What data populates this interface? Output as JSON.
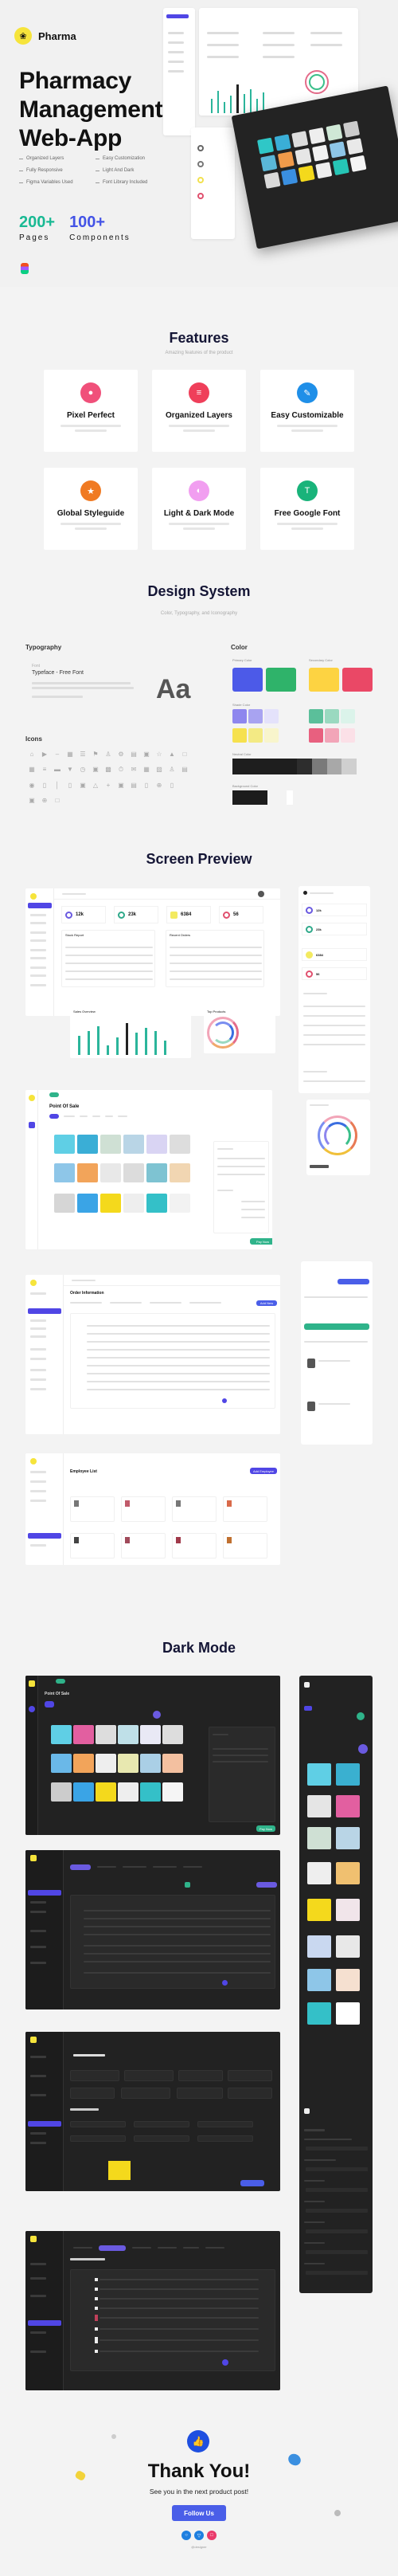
{
  "hero": {
    "brand": "Pharma",
    "title_lines": [
      "Pharmacy",
      "Management",
      "Web-App"
    ],
    "features": [
      "Organized Layers",
      "Easy Customization",
      "Fully Responsive",
      "Light And Dark",
      "Figma Variables Used",
      "Font Library Included"
    ],
    "stats": [
      {
        "value": "200+",
        "label": "Pages"
      },
      {
        "value": "100+",
        "label": "Components"
      }
    ]
  },
  "features_section": {
    "title": "Features",
    "subtitle": "Amazing features of the product",
    "items": [
      {
        "title": "Pixel Perfect",
        "icon": "pixel-icon",
        "color": "#f0507a"
      },
      {
        "title": "Organized Layers",
        "icon": "layers-icon",
        "color": "#ef3f5a"
      },
      {
        "title": "Easy Customizable",
        "icon": "customize-icon",
        "color": "#1f8fe8"
      },
      {
        "title": "Global Styleguide",
        "icon": "styleguide-icon",
        "color": "#f07a22"
      },
      {
        "title": "Light & Dark Mode",
        "icon": "theme-icon",
        "color": "#f19ef0"
      },
      {
        "title": "Free Google Font",
        "icon": "font-icon",
        "color": "#19b37a"
      }
    ]
  },
  "design_system": {
    "title": "Design System",
    "subtitle": "Color, Typography, and Iconography",
    "typography_label": "Typography",
    "font_caption": "Font",
    "font_name": "Typeface - Free Font",
    "sample_glyph": "Aa",
    "icons_label": "Icons",
    "color_label": "Color",
    "primary_label": "Primary Color",
    "secondary_label": "Secondary Color",
    "shade_label": "Shade Color",
    "neutral_label": "Neutral Color",
    "background_label": "Background Color",
    "colors": {
      "primary": [
        "#4c5ae8",
        "#2fb36a"
      ],
      "secondary": [
        "#fdd342",
        "#ea4866"
      ],
      "shades_purple": [
        "#8e86ee",
        "#a8a3f1",
        "#e4e2fb"
      ],
      "shades_green": [
        "#5bbf9a",
        "#9ad9c0",
        "#dbf3ea"
      ],
      "shades_yellow": [
        "#f6e14e",
        "#f3ea84",
        "#f8f5cc"
      ],
      "shades_pink": [
        "#e8607f",
        "#f2a5b8",
        "#fbe0e7"
      ],
      "neutral": [
        "#1e1e1e",
        "#2d2d2d",
        "#7a7a7a",
        "#a8a8a8",
        "#cfcfcf"
      ],
      "background": [
        "#1c1c1c",
        "#ffffff"
      ]
    }
  },
  "screen_preview": {
    "title": "Screen Preview",
    "dashboard": {
      "stats": [
        "12k",
        "23k",
        "6384",
        "56"
      ],
      "stat_colors": [
        "#6a5ae0",
        "#2fa98a",
        "#f3ea60",
        "#e0506e"
      ],
      "table_titles": [
        "Stock Report",
        "Recent Orders"
      ],
      "chart_title": "Sales Overview",
      "donut_title": "Top Products"
    },
    "pos": {
      "title": "Point Of Sale",
      "pay_button": "Pay Now"
    },
    "orders": {
      "title": "Order Information",
      "add_button": "Add New"
    },
    "employees": {
      "title": "Employee List",
      "add_button": "Add Employee"
    }
  },
  "dark_mode": {
    "title": "Dark Mode"
  },
  "thank_you": {
    "title": "Thank You!",
    "subtitle": "See you in the next product post!",
    "button": "Follow Us",
    "handle": "@designer",
    "social": [
      "dribbble-icon",
      "behance-icon",
      "instagram-icon"
    ],
    "social_colors": [
      "#1e7fe0",
      "#1e7fe0",
      "#ea3a6a"
    ]
  }
}
